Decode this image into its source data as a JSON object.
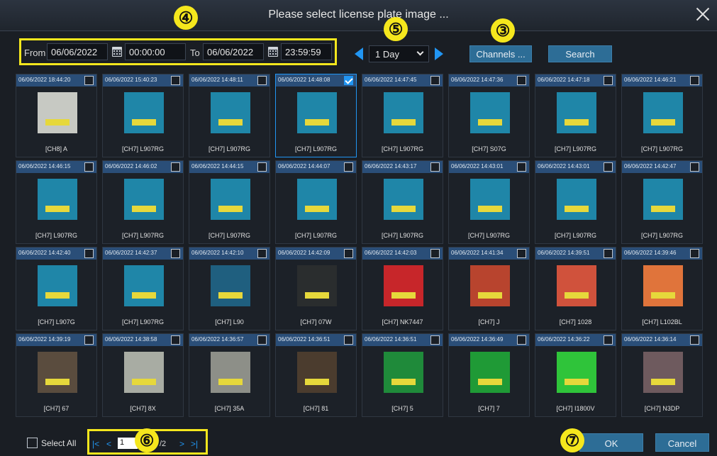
{
  "dialog": {
    "title": "Please select license plate image ..."
  },
  "filters": {
    "from_label": "From",
    "from_date": "06/06/2022",
    "from_time": "00:00:00",
    "to_label": "To",
    "to_date": "06/06/2022",
    "to_time": "23:59:59",
    "range_value": "1 Day",
    "channels_label": "Channels ...",
    "search_label": "Search"
  },
  "badges": [
    "④",
    "⑤",
    "③",
    "⑥",
    "⑦"
  ],
  "cards": [
    {
      "time": "06/06/2022 18:44:20",
      "label": "[CH8] A",
      "checked": false,
      "bg": "#c7c9c3"
    },
    {
      "time": "06/06/2022 15:40:23",
      "label": "[CH7] L907RG",
      "checked": false,
      "bg": "#1f86a8"
    },
    {
      "time": "06/06/2022 14:48:11",
      "label": "[CH7] L907RG",
      "checked": false,
      "bg": "#1f86a8"
    },
    {
      "time": "06/06/2022 14:48:08",
      "label": "[CH7] L907RG",
      "checked": true,
      "bg": "#1f86a8"
    },
    {
      "time": "06/06/2022 14:47:45",
      "label": "[CH7] L907RG",
      "checked": false,
      "bg": "#1f86a8"
    },
    {
      "time": "06/06/2022 14:47:36",
      "label": "[CH7] S07G",
      "checked": false,
      "bg": "#1f86a8"
    },
    {
      "time": "06/06/2022 14:47:18",
      "label": "[CH7] L907RG",
      "checked": false,
      "bg": "#1f86a8"
    },
    {
      "time": "06/06/2022 14:46:21",
      "label": "[CH7] L907RG",
      "checked": false,
      "bg": "#1f86a8"
    },
    {
      "time": "06/06/2022 14:46:15",
      "label": "[CH7] L907RG",
      "checked": false,
      "bg": "#1f86a8"
    },
    {
      "time": "06/06/2022 14:46:02",
      "label": "[CH7] L907RG",
      "checked": false,
      "bg": "#1f86a8"
    },
    {
      "time": "06/06/2022 14:44:15",
      "label": "[CH7] L907RG",
      "checked": false,
      "bg": "#1f86a8"
    },
    {
      "time": "06/06/2022 14:44:07",
      "label": "[CH7] L907RG",
      "checked": false,
      "bg": "#1f86a8"
    },
    {
      "time": "06/06/2022 14:43:17",
      "label": "[CH7] L907RG",
      "checked": false,
      "bg": "#1f86a8"
    },
    {
      "time": "06/06/2022 14:43:01",
      "label": "[CH7] L907RG",
      "checked": false,
      "bg": "#1f86a8"
    },
    {
      "time": "06/06/2022 14:43:01",
      "label": "[CH7] L907RG",
      "checked": false,
      "bg": "#1f86a8"
    },
    {
      "time": "06/06/2022 14:42:47",
      "label": "[CH7] L907RG",
      "checked": false,
      "bg": "#1f86a8"
    },
    {
      "time": "06/06/2022 14:42:40",
      "label": "[CH7] L907G",
      "checked": false,
      "bg": "#1f86a8"
    },
    {
      "time": "06/06/2022 14:42:37",
      "label": "[CH7] L907RG",
      "checked": false,
      "bg": "#1f86a8"
    },
    {
      "time": "06/06/2022 14:42:10",
      "label": "[CH7] L90",
      "checked": false,
      "bg": "#1f5f7f"
    },
    {
      "time": "06/06/2022 14:42:09",
      "label": "[CH7] 07W",
      "checked": false,
      "bg": "#2a2d2e"
    },
    {
      "time": "06/06/2022 14:42:03",
      "label": "[CH7] NK7447",
      "checked": false,
      "bg": "#c7262a"
    },
    {
      "time": "06/06/2022 14:41:34",
      "label": "[CH7] J",
      "checked": false,
      "bg": "#b8442e"
    },
    {
      "time": "06/06/2022 14:39:51",
      "label": "[CH7] 1028",
      "checked": false,
      "bg": "#d0523c"
    },
    {
      "time": "06/06/2022 14:39:46",
      "label": "[CH7] L102BL",
      "checked": false,
      "bg": "#e0743b"
    },
    {
      "time": "06/06/2022 14:39:19",
      "label": "[CH7] 67",
      "checked": false,
      "bg": "#5a4c3e"
    },
    {
      "time": "06/06/2022 14:38:58",
      "label": "[CH7] 8X",
      "checked": false,
      "bg": "#a8aca3"
    },
    {
      "time": "06/06/2022 14:36:57",
      "label": "[CH7] 35A",
      "checked": false,
      "bg": "#8d8f88"
    },
    {
      "time": "06/06/2022 14:36:51",
      "label": "[CH7] 81",
      "checked": false,
      "bg": "#4b3c2e"
    },
    {
      "time": "06/06/2022 14:36:51",
      "label": "[CH7] 5",
      "checked": false,
      "bg": "#1f8a3a"
    },
    {
      "time": "06/06/2022 14:36:49",
      "label": "[CH7] 7",
      "checked": false,
      "bg": "#1f9a36"
    },
    {
      "time": "06/06/2022 14:36:22",
      "label": "[CH7] I1800V",
      "checked": false,
      "bg": "#2fc43a"
    },
    {
      "time": "06/06/2022 14:36:14",
      "label": "[CH7] N3DP",
      "checked": false,
      "bg": "#6e5a5e"
    }
  ],
  "footer": {
    "select_all_label": "Select All",
    "first_glyph": "|<",
    "prev_glyph": "<",
    "page_current": "1",
    "page_total": "/2",
    "next_glyph": ">",
    "last_glyph": ">|",
    "ok_label": "OK",
    "cancel_label": "Cancel"
  }
}
